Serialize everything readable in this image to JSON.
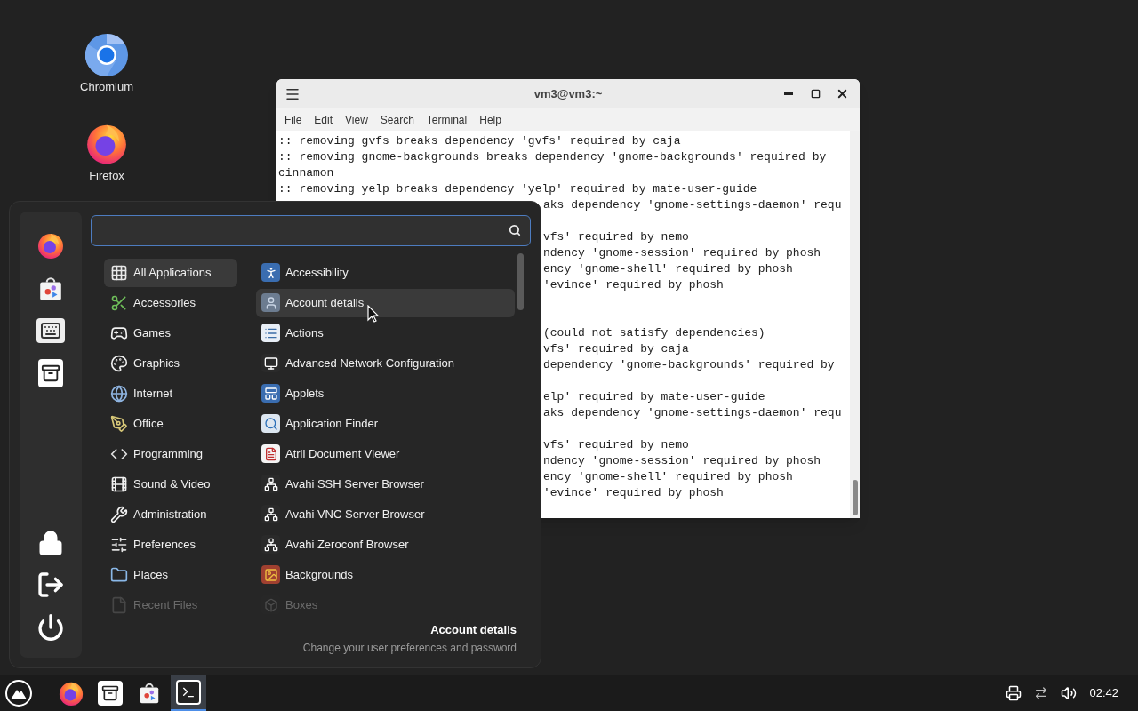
{
  "desktop_icons": [
    {
      "label": "Chromium"
    },
    {
      "label": "Firefox"
    }
  ],
  "terminal": {
    "title": "vm3@vm3:~",
    "menu": [
      "File",
      "Edit",
      "View",
      "Search",
      "Terminal",
      "Help"
    ],
    "lines": [
      ":: removing gvfs breaks dependency 'gvfs' required by caja",
      ":: removing gnome-backgrounds breaks dependency 'gnome-backgrounds' required by",
      "cinnamon",
      ":: removing yelp breaks dependency 'yelp' required by mate-user-guide"
    ],
    "covered_lines": [
      {
        "kind": "partial",
        "text": "aks dependency 'gnome-settings-daemon' requ"
      },
      {
        "kind": "covered"
      },
      {
        "kind": "partial",
        "text": "vfs' required by nemo"
      },
      {
        "kind": "partial",
        "text": "ndency 'gnome-session' required by phosh"
      },
      {
        "kind": "partial",
        "text": "ency 'gnome-shell' required by phosh"
      },
      {
        "kind": "partial",
        "text": "'evince' required by phosh"
      },
      {
        "kind": "covered"
      },
      {
        "kind": "covered"
      },
      {
        "kind": "partial",
        "text": "(could not satisfy dependencies)"
      },
      {
        "kind": "partial",
        "text": "vfs' required by caja"
      },
      {
        "kind": "partial",
        "text": "dependency 'gnome-backgrounds' required by"
      },
      {
        "kind": "covered"
      },
      {
        "kind": "partial",
        "text": "elp' required by mate-user-guide"
      },
      {
        "kind": "partial",
        "text": "aks dependency 'gnome-settings-daemon' requ"
      },
      {
        "kind": "covered"
      },
      {
        "kind": "partial",
        "text": "vfs' required by nemo"
      },
      {
        "kind": "partial",
        "text": "ndency 'gnome-session' required by phosh"
      },
      {
        "kind": "partial",
        "text": "ency 'gnome-shell' required by phosh"
      },
      {
        "kind": "partial",
        "text": "'evince' required by phosh"
      }
    ]
  },
  "app_menu": {
    "categories": [
      {
        "label": "All Applications",
        "selected": true,
        "disabled": false
      },
      {
        "label": "Accessories",
        "selected": false,
        "disabled": false
      },
      {
        "label": "Games",
        "selected": false,
        "disabled": false
      },
      {
        "label": "Graphics",
        "selected": false,
        "disabled": false
      },
      {
        "label": "Internet",
        "selected": false,
        "disabled": false
      },
      {
        "label": "Office",
        "selected": false,
        "disabled": false
      },
      {
        "label": "Programming",
        "selected": false,
        "disabled": false
      },
      {
        "label": "Sound & Video",
        "selected": false,
        "disabled": false
      },
      {
        "label": "Administration",
        "selected": false,
        "disabled": false
      },
      {
        "label": "Preferences",
        "selected": false,
        "disabled": false
      },
      {
        "label": "Places",
        "selected": false,
        "disabled": false
      },
      {
        "label": "Recent Files",
        "selected": false,
        "disabled": true
      }
    ],
    "apps": [
      {
        "label": "Accessibility",
        "selected": false,
        "disabled": false
      },
      {
        "label": "Account details",
        "selected": true,
        "disabled": false
      },
      {
        "label": "Actions",
        "selected": false,
        "disabled": false
      },
      {
        "label": "Advanced Network Configuration",
        "selected": false,
        "disabled": false
      },
      {
        "label": "Applets",
        "selected": false,
        "disabled": false
      },
      {
        "label": "Application Finder",
        "selected": false,
        "disabled": false
      },
      {
        "label": "Atril Document Viewer",
        "selected": false,
        "disabled": false
      },
      {
        "label": "Avahi SSH Server Browser",
        "selected": false,
        "disabled": false
      },
      {
        "label": "Avahi VNC Server Browser",
        "selected": false,
        "disabled": false
      },
      {
        "label": "Avahi Zeroconf Browser",
        "selected": false,
        "disabled": false
      },
      {
        "label": "Backgrounds",
        "selected": false,
        "disabled": false
      },
      {
        "label": "Boxes",
        "selected": false,
        "disabled": true
      }
    ],
    "detail": {
      "title": "Account details",
      "description": "Change your user preferences and password"
    }
  },
  "taskbar": {
    "items": [
      {
        "kind": "browser",
        "selected": false
      },
      {
        "kind": "files",
        "selected": false
      },
      {
        "kind": "store",
        "selected": false
      },
      {
        "kind": "terminal",
        "selected": true
      }
    ],
    "clock": "02:42"
  }
}
